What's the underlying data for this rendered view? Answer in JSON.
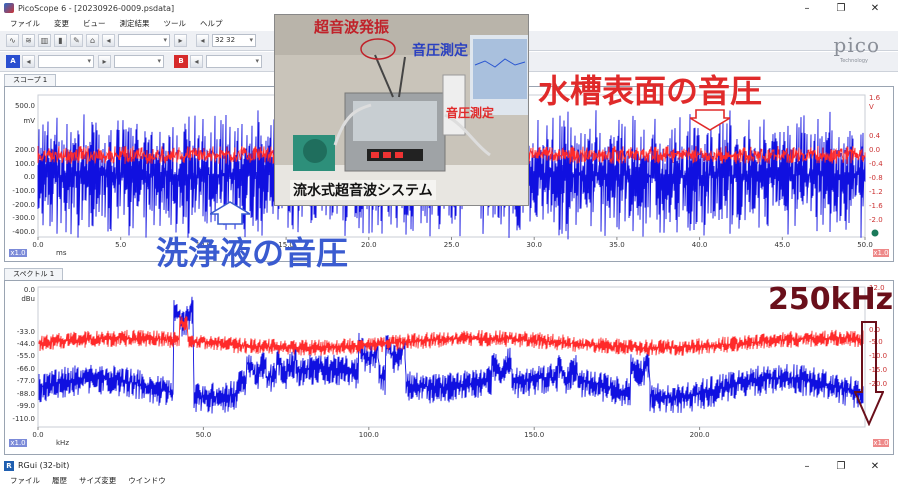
{
  "window": {
    "title": "PicoScope 6 - [20230926-0009.psdata]",
    "controls": [
      "–",
      "❐",
      "✕"
    ]
  },
  "menu": [
    "ファイル",
    "変更",
    "ビュー",
    "測定結果",
    "ツール",
    "ヘルプ"
  ],
  "toolbar": {
    "timebase_value": "32 32",
    "channel_a_label": "A",
    "channel_b_label": "B"
  },
  "logo": {
    "text": "pico",
    "sub": "Technology"
  },
  "scope": {
    "tab_label": "スコープ 1",
    "left_axis": {
      "unit": "mV",
      "ticks": [
        "500.0",
        "200.0",
        "100.0",
        "0.0",
        "-100.0",
        "-200.0",
        "-300.0",
        "-400.0"
      ]
    },
    "right_axis": {
      "unit": "V",
      "ticks": [
        "1.6",
        "0.4",
        "0.0",
        "-0.4",
        "-0.8",
        "-1.2",
        "-1.6",
        "-2.0"
      ]
    },
    "x_ticks": [
      "0.0",
      "5.0",
      "10.0",
      "15.0",
      "20.0",
      "25.0",
      "30.0",
      "35.0",
      "40.0",
      "45.0",
      "50.0"
    ],
    "x_unit": "ms",
    "x_scale_badge": "x1.0",
    "right_badge": "x1.0"
  },
  "spectrum": {
    "tab_label": "スペクトル 1",
    "left_axis": {
      "unit": "dBu",
      "ticks": [
        "0.0",
        "-33.0",
        "-44.0",
        "-55.0",
        "-66.0",
        "-77.0",
        "-88.0",
        "-99.0",
        "-110.0"
      ]
    },
    "right_axis": {
      "ticks": [
        "12.0",
        "0.0",
        "-5.0",
        "-10.0",
        "-15.0",
        "-20.0"
      ]
    },
    "x_ticks": [
      "0.0",
      "50.0",
      "100.0",
      "150.0",
      "200.0"
    ],
    "x_unit": "kHz",
    "x_scale_badge": "x1.0",
    "right_badge": "x1.0"
  },
  "annotations": {
    "tank_surface": "水槽表面の音圧",
    "cleaning_liquid": "洗浄液の音圧",
    "freq_250": "250kHz",
    "photo_caption": "流水式超音波システム",
    "photo_ultrasonic": "超音波発振",
    "photo_measure1": "音圧測定",
    "photo_measure2": "音圧測定"
  },
  "rgui": {
    "title": "RGui (32-bit)",
    "menu": [
      "ファイル",
      "履歴",
      "サイズ変更",
      "ウインドウ"
    ]
  },
  "colors": {
    "red_trace": "#ff2a2a",
    "blue_trace": "#1010e0",
    "annot_blue": "#3a5bd0",
    "annot_red": "#e02a2a",
    "annot_dark": "#6a0f1a"
  }
}
